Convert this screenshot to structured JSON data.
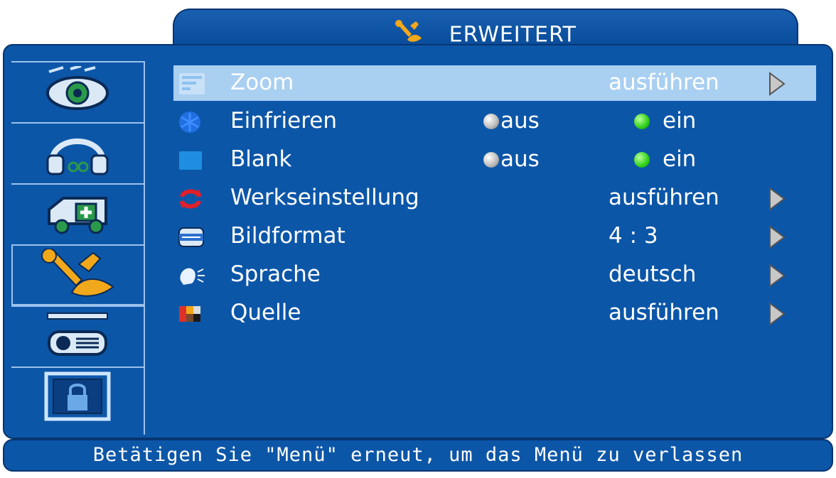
{
  "header": {
    "title": "ERWEITERT",
    "icon": "tools-icon"
  },
  "sidebar": {
    "items": [
      {
        "icon": "picture-eye-icon"
      },
      {
        "icon": "audio-headphones-icon"
      },
      {
        "icon": "setup-vehicle-icon"
      },
      {
        "icon": "tools-icon"
      },
      {
        "icon": "projector-icon"
      },
      {
        "icon": "lock-icon"
      }
    ],
    "active_index": 3
  },
  "menu": {
    "rows": [
      {
        "label": "Zoom",
        "value": "ausführen",
        "type": "action",
        "icon": "zoom-icon"
      },
      {
        "label": "Einfrieren",
        "off_label": "aus",
        "on_label": "ein",
        "selected": "ein",
        "type": "toggle",
        "icon": "freeze-snowflake-icon"
      },
      {
        "label": "Blank",
        "off_label": "aus",
        "on_label": "ein",
        "selected": "ein",
        "type": "toggle",
        "icon": "blank-screen-icon"
      },
      {
        "label": "Werkseinstellung",
        "value": "ausführen",
        "type": "action",
        "icon": "reset-icon"
      },
      {
        "label": "Bildformat",
        "value": "4 : 3",
        "type": "action",
        "icon": "aspect-ratio-icon"
      },
      {
        "label": "Sprache",
        "value": "deutsch",
        "type": "action",
        "icon": "language-speech-icon"
      },
      {
        "label": "Quelle",
        "value": "ausführen",
        "type": "action",
        "icon": "source-icon"
      }
    ],
    "highlighted_index": 0
  },
  "status": {
    "text": "Betätigen Sie \"Menü\" erneut, um das Menü zu verlassen"
  },
  "colors": {
    "panel": "#0c56a8",
    "highlight": "#a9cff1",
    "border": "#07356f",
    "divider": "#9bc2ec"
  }
}
